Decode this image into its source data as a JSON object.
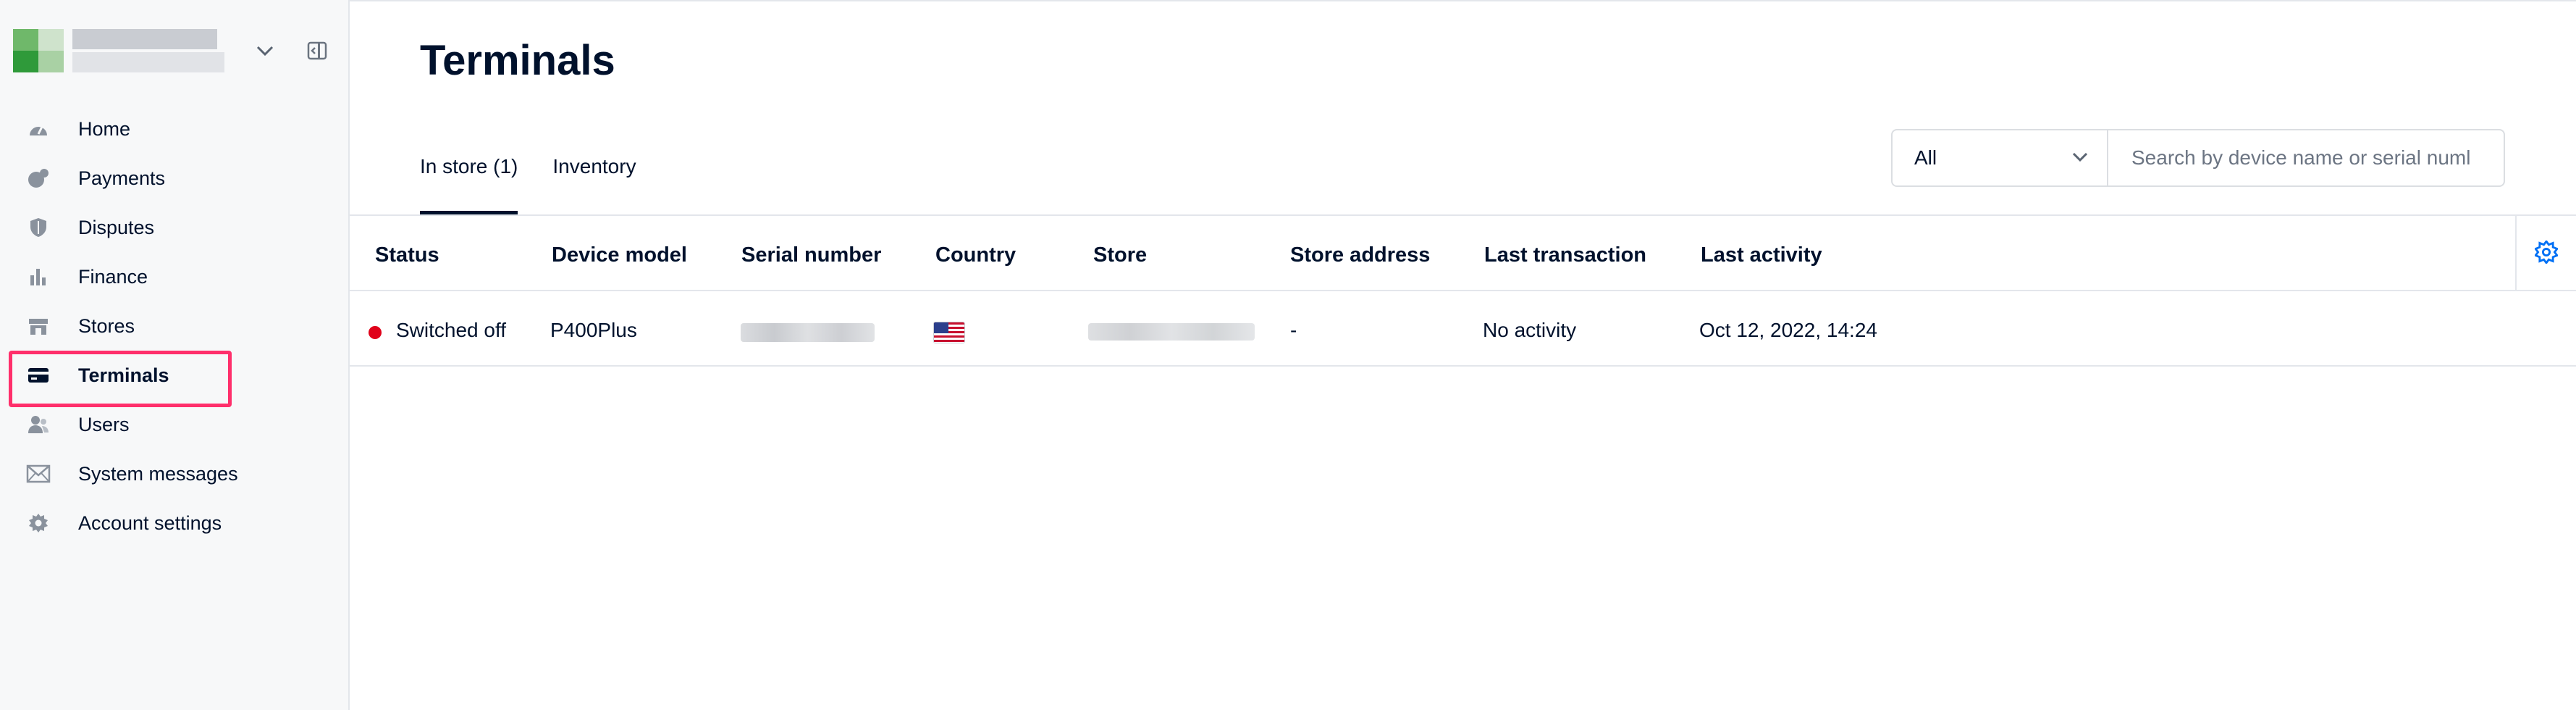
{
  "sidebar": {
    "items": [
      {
        "label": "Home",
        "icon": "dashboard-gauge-icon"
      },
      {
        "label": "Payments",
        "icon": "payments-icon"
      },
      {
        "label": "Disputes",
        "icon": "shield-icon"
      },
      {
        "label": "Finance",
        "icon": "bar-chart-icon"
      },
      {
        "label": "Stores",
        "icon": "store-icon"
      },
      {
        "label": "Terminals",
        "icon": "card-icon",
        "active": true
      },
      {
        "label": "Users",
        "icon": "users-icon"
      },
      {
        "label": "System messages",
        "icon": "envelope-icon"
      },
      {
        "label": "Account settings",
        "icon": "gear-icon"
      }
    ]
  },
  "page": {
    "title": "Terminals"
  },
  "tabs": [
    {
      "label": "In store (1)",
      "active": true
    },
    {
      "label": "Inventory",
      "active": false
    }
  ],
  "filter": {
    "selected": "All",
    "search_placeholder": "Search by device name or serial numl"
  },
  "table": {
    "columns": [
      "Status",
      "Device model",
      "Serial number",
      "Country",
      "Store",
      "Store address",
      "Last transaction",
      "Last activity"
    ],
    "rows": [
      {
        "status": "Switched off",
        "device_model": "P400Plus",
        "store_address": "-",
        "last_transaction": "No activity",
        "last_activity": "Oct 12, 2022, 14:24"
      }
    ]
  },
  "colors": {
    "text": "#00112c",
    "accent_highlight": "#ff2f6b",
    "status_off": "#e0021a",
    "settings_icon": "#0070f5"
  }
}
